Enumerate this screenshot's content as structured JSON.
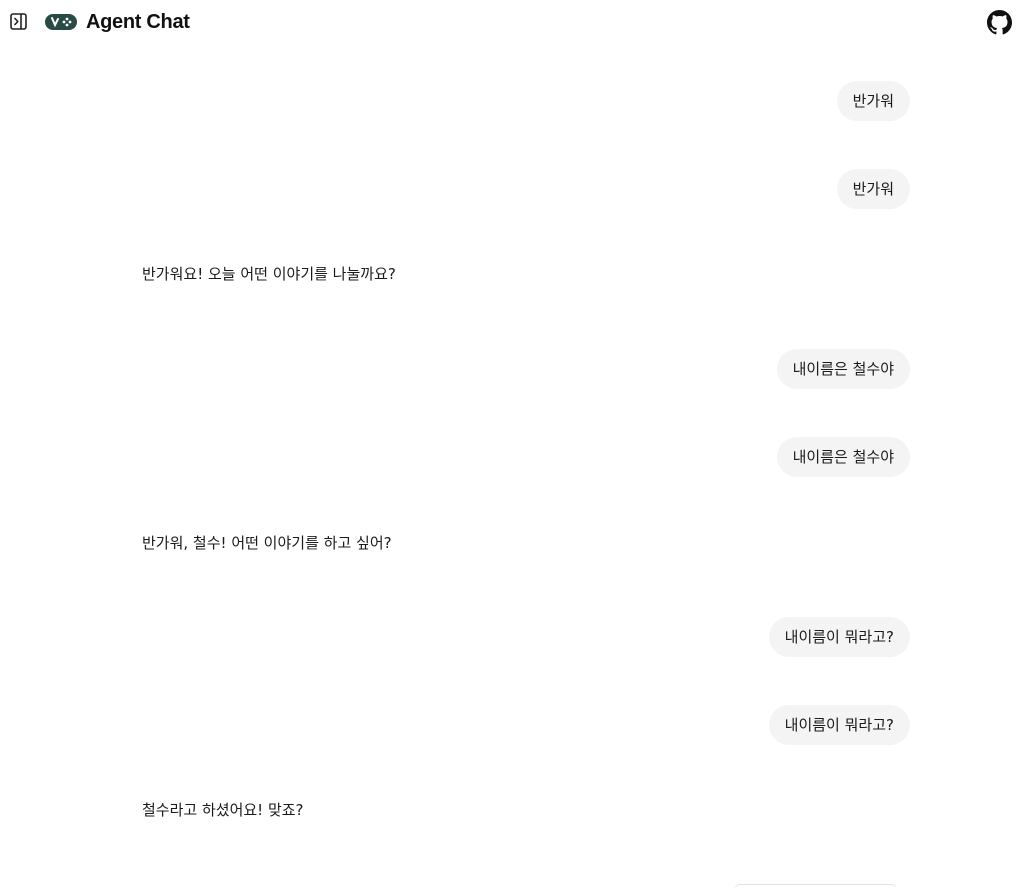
{
  "header": {
    "title": "Agent Chat",
    "sidebar_toggle_icon": "sidebar-toggle-icon",
    "logo_icon": "gamepad-logo-icon",
    "github_icon": "github-icon",
    "logo_color": "#2a4a46"
  },
  "messages": [
    {
      "role": "user",
      "text": "반가워"
    },
    {
      "role": "user",
      "text": "반가워"
    },
    {
      "role": "assistant",
      "text": "반가워요! 오늘 어떤 이야기를 나눌까요?"
    },
    {
      "role": "user",
      "text": "내이름은 철수야"
    },
    {
      "role": "user",
      "text": "내이름은 철수야"
    },
    {
      "role": "assistant",
      "text": "반가워, 철수! 어떤 이야기를 하고 싶어?"
    },
    {
      "role": "user",
      "text": "내이름이 뭐라고?"
    },
    {
      "role": "user",
      "text": "내이름이 뭐라고?"
    },
    {
      "role": "assistant",
      "text": "철수라고 하셨어요! 맞죠?"
    }
  ]
}
